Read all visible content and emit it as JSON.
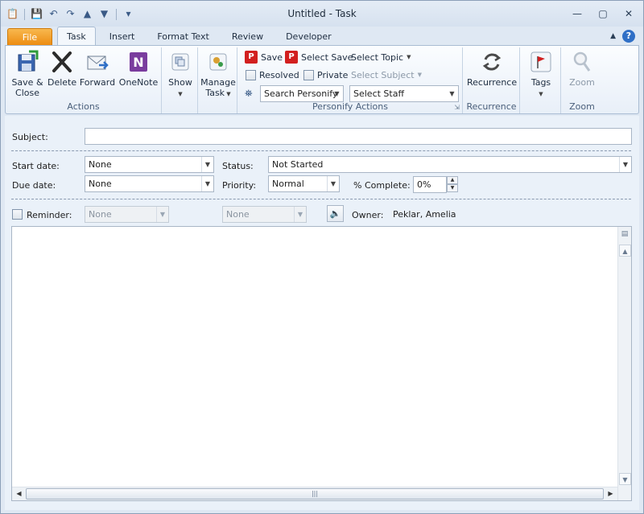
{
  "window": {
    "title": "Untitled  -  Task"
  },
  "tabs": [
    "File",
    "Task",
    "Insert",
    "Format Text",
    "Review",
    "Developer"
  ],
  "ribbon": {
    "actions": {
      "label": "Actions",
      "save_close": "Save &\nClose",
      "delete": "Delete",
      "forward": "Forward",
      "onenote": "OneNote"
    },
    "show": {
      "label": "Show"
    },
    "manage": {
      "label": "Manage\nTask"
    },
    "personify": {
      "label": "Personify Actions",
      "save": "Save",
      "select_save": "Select Save",
      "select_topic": "Select Topic",
      "resolved": "Resolved",
      "private": "Private",
      "select_subject": "Select Subject",
      "search": "Search Personify",
      "select_staff": "Select Staff"
    },
    "recurrence": {
      "button": "Recurrence",
      "label": "Recurrence"
    },
    "tags": {
      "button": "Tags"
    },
    "zoom": {
      "button": "Zoom",
      "label": "Zoom"
    }
  },
  "form": {
    "subject_label": "Subject:",
    "subject_value": "",
    "start_label": "Start date:",
    "start_value": "None",
    "due_label": "Due date:",
    "due_value": "None",
    "status_label": "Status:",
    "status_value": "Not Started",
    "priority_label": "Priority:",
    "priority_value": "Normal",
    "complete_label": "% Complete:",
    "complete_value": "0%",
    "reminder_label": "Reminder:",
    "reminder_date": "None",
    "reminder_time": "None",
    "owner_label": "Owner:",
    "owner_value": "Peklar, Amelia"
  },
  "colors": {
    "file_tab": "#ec8a0e",
    "accent": "#2f6fc6",
    "personify_red": "#d21f1f"
  }
}
